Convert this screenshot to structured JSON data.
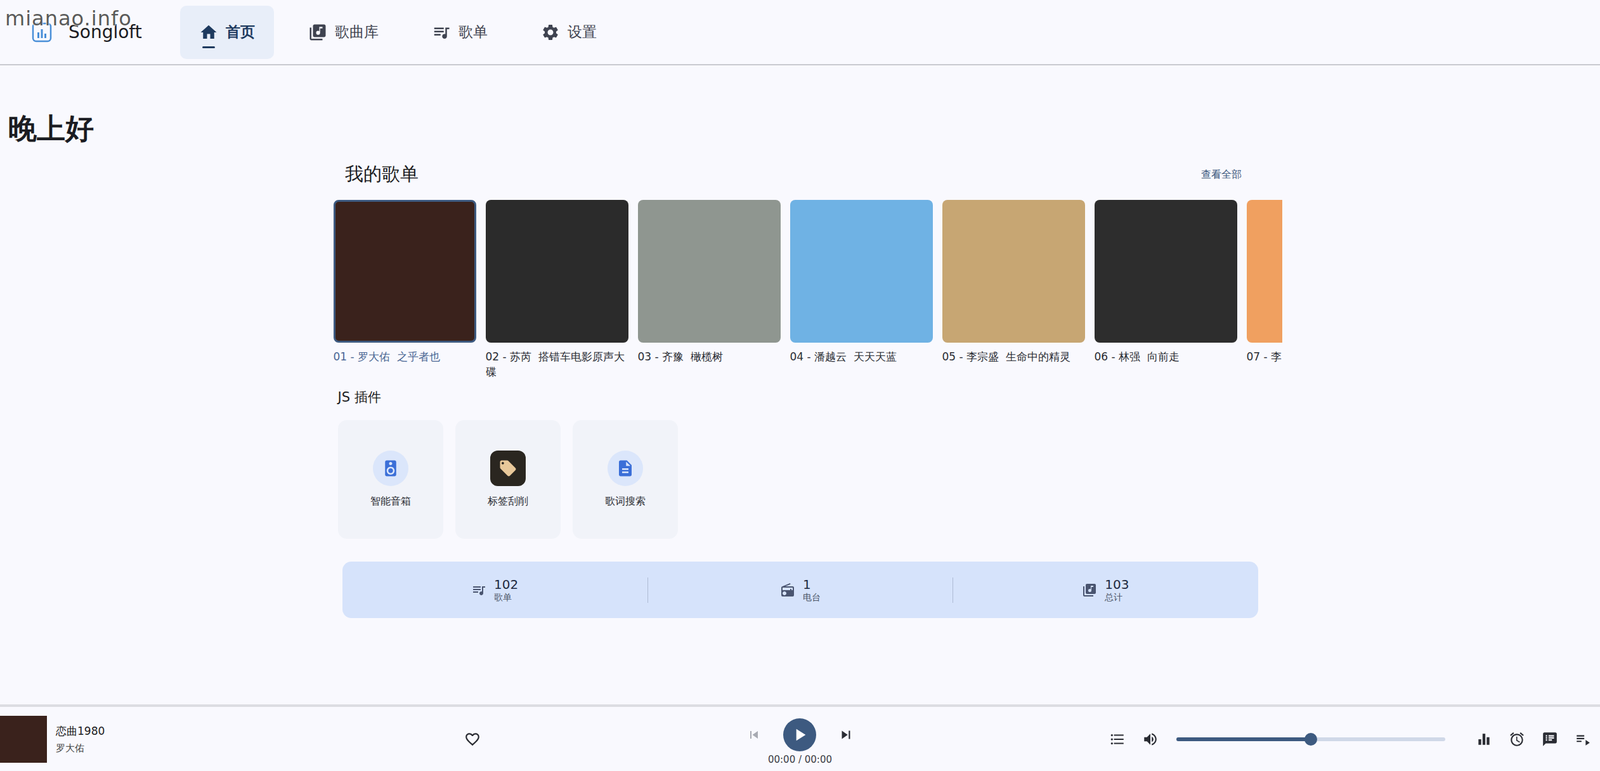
{
  "watermark": "mianao.info",
  "app": {
    "name": "Songloft"
  },
  "nav": [
    {
      "label": "首页",
      "selected": true
    },
    {
      "label": "歌曲库",
      "selected": false
    },
    {
      "label": "歌单",
      "selected": false
    },
    {
      "label": "设置",
      "selected": false
    }
  ],
  "greeting": "晚上好",
  "playlists": {
    "title": "我的歌单",
    "view_all": "查看全部",
    "items": [
      {
        "label": "01 - 罗大佑  之乎者也",
        "selected": true
      },
      {
        "label": "02 - 苏芮  搭错车电影原声大碟",
        "selected": false
      },
      {
        "label": "03 - 齐豫  橄榄树",
        "selected": false
      },
      {
        "label": "04 - 潘越云  天天天蓝",
        "selected": false
      },
      {
        "label": "05 - 李宗盛  生命中的精灵",
        "selected": false
      },
      {
        "label": "06 - 林强  向前走",
        "selected": false
      },
      {
        "label": "07 - 李",
        "selected": false
      }
    ]
  },
  "plugins": {
    "title": "JS 插件",
    "items": [
      {
        "label": "智能音箱"
      },
      {
        "label": "标签刮削"
      },
      {
        "label": "歌词搜索"
      }
    ]
  },
  "stats": [
    {
      "value": "102",
      "label": "歌单"
    },
    {
      "value": "1",
      "label": "电台"
    },
    {
      "value": "103",
      "label": "总计"
    }
  ],
  "player": {
    "title": "恋曲1980",
    "artist": "罗大佑",
    "liked": false,
    "playing": false,
    "prev_disabled": true,
    "time": "00:00 / 00:00",
    "volume": 0.5
  }
}
